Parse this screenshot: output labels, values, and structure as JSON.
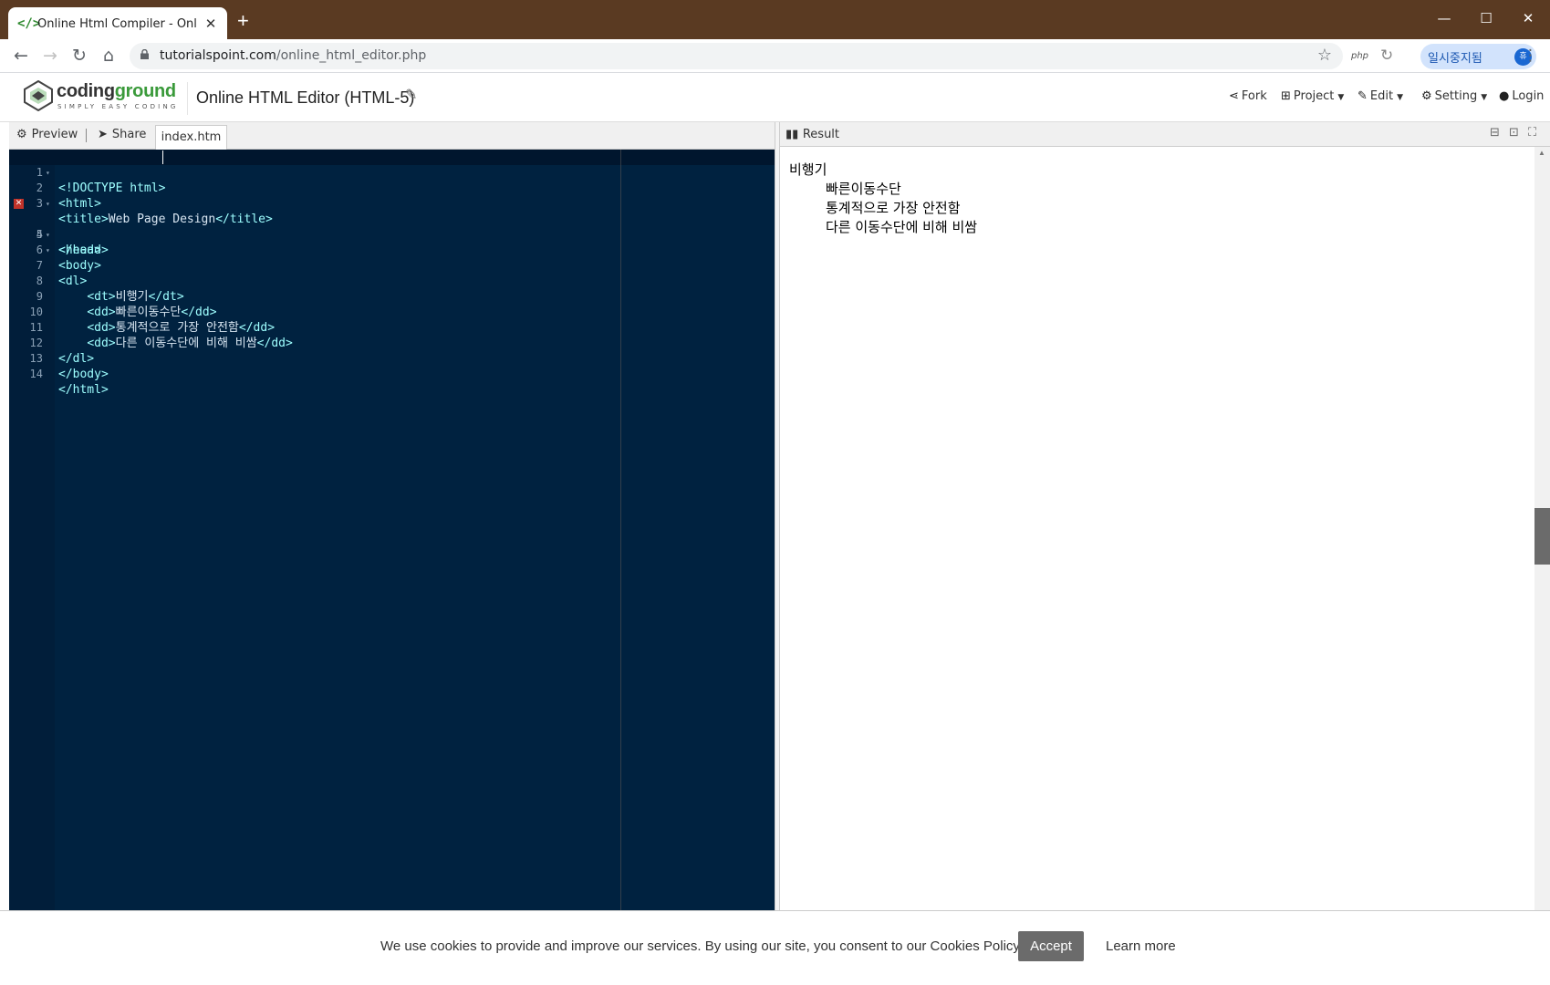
{
  "browser": {
    "tab_title": "Online Html Compiler - Online H",
    "favicon": "</>",
    "url_host": "tutorialspoint.com",
    "url_path": "/online_html_editor.php",
    "ext_php": "php",
    "profile_label": "일시중지됨",
    "profile_initial": "휴"
  },
  "site": {
    "logo_prefix": "coding",
    "logo_suffix": "ground",
    "logo_tagline": "SIMPLY EASY CODING",
    "page_title": "Online HTML Editor (HTML-5)",
    "menu": {
      "fork": "Fork",
      "project": "Project",
      "edit": "Edit",
      "setting": "Setting",
      "login": "Login"
    }
  },
  "editor": {
    "preview_label": "Preview",
    "share_label": "Share",
    "file_tab": "index.htm",
    "error_line": 4,
    "lines": [
      "1",
      "2",
      "3",
      "4",
      "5",
      "6",
      "7",
      "8",
      "9",
      "10",
      "11",
      "12",
      "13",
      "14"
    ]
  },
  "result": {
    "title": "Result",
    "dt": "비행기",
    "dd": [
      "빠른이동수단",
      "통계적으로 가장 안전함",
      "다른 이동수단에 비해 비쌈"
    ]
  },
  "cookie": {
    "text": "We use cookies to provide and improve our services. By using our site, you consent to our Cookies Policy.",
    "accept": "Accept",
    "learn_more": "Learn more"
  },
  "colors": {
    "titlebar": "#5a3a22",
    "editor_bg": "#002240",
    "tag_color": "#9effff",
    "accent_green": "#3a9a3a",
    "profile_blue": "#1967d2"
  }
}
